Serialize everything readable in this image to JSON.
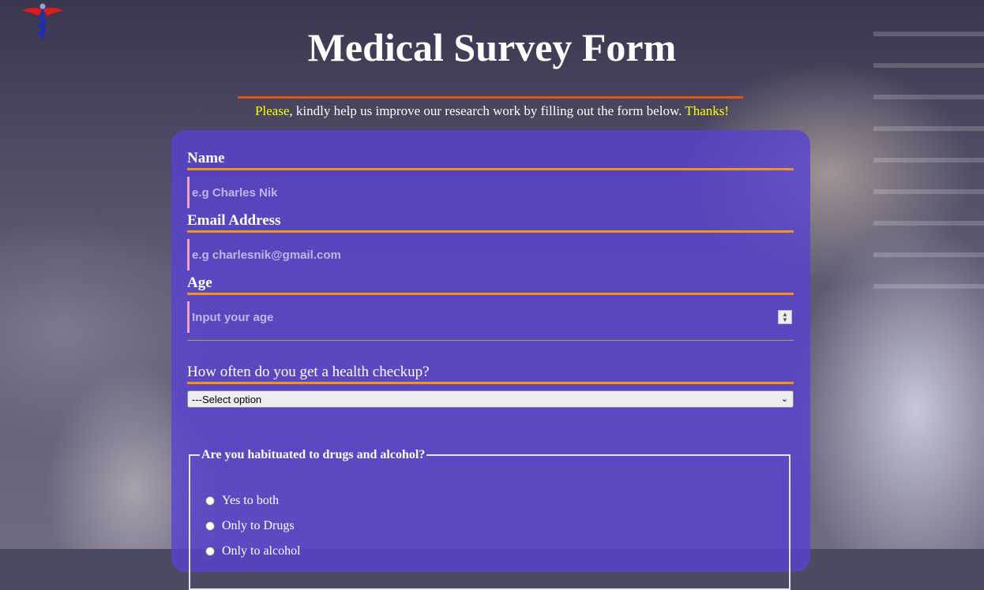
{
  "header": {
    "title": "Medical Survey Form",
    "subtitle_lead": "Please",
    "subtitle_body": ", kindly help us improve our research work by filling out the form below. ",
    "subtitle_tail": "Thanks!"
  },
  "colors": {
    "accent_orange": "#f3921f",
    "title_rule": "#e2541c",
    "highlight_yellow": "#ffff00",
    "card_purple": "#5842d2"
  },
  "form": {
    "name": {
      "label": "Name",
      "placeholder": "e.g Charles Nik"
    },
    "email": {
      "label": "Email Address",
      "placeholder": "e.g charlesnik@gmail.com"
    },
    "age": {
      "label": "Age",
      "placeholder": "Input your age"
    },
    "checkup": {
      "label": "How often do you get a health checkup?",
      "selected": "---Select option"
    },
    "habits": {
      "legend": "Are you habituated to drugs and alcohol?",
      "options": [
        "Yes to both",
        "Only to Drugs",
        "Only to alcohol"
      ]
    }
  },
  "icons": {
    "logo": "caduceus-icon",
    "spinner": "number-spinner-icon",
    "select": "chevron-down-icon"
  }
}
